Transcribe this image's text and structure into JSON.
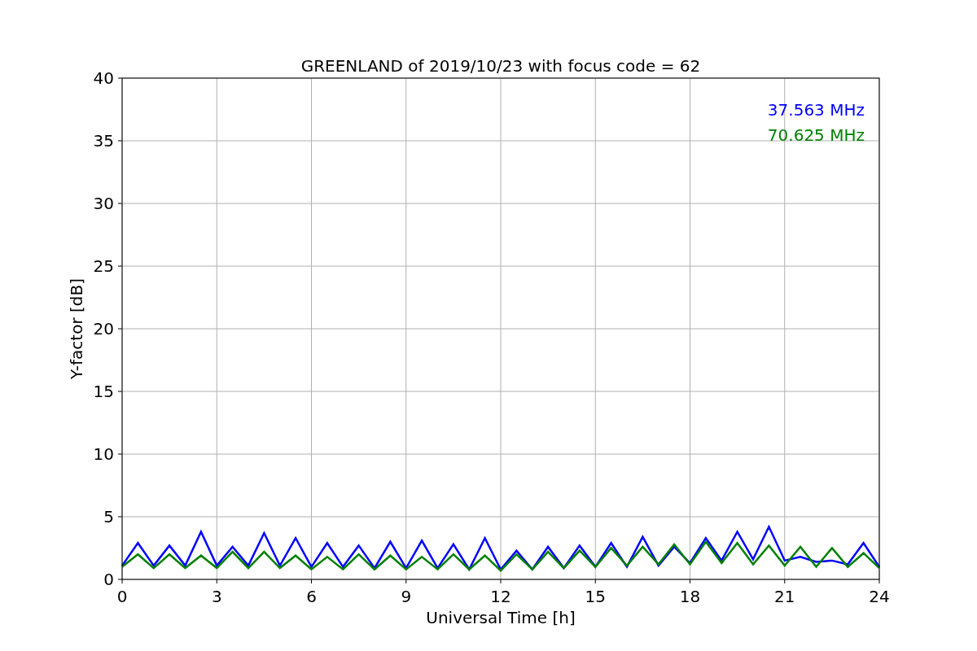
{
  "chart_data": {
    "type": "line",
    "title": "GREENLAND of 2019/10/23 with focus code = 62",
    "xlabel": "Universal Time [h]",
    "ylabel": "Y-factor [dB]",
    "x": [
      0,
      0.5,
      1,
      1.5,
      2,
      2.5,
      3,
      3.5,
      4,
      4.5,
      5,
      5.5,
      6,
      6.5,
      7,
      7.5,
      8,
      8.5,
      9,
      9.5,
      10,
      10.5,
      11,
      11.5,
      12,
      12.5,
      13,
      13.5,
      14,
      14.5,
      15,
      15.5,
      16,
      16.5,
      17,
      17.5,
      18,
      18.5,
      19,
      19.5,
      20,
      20.5,
      21,
      21.5,
      22,
      22.5,
      23,
      23.5,
      24
    ],
    "series": [
      {
        "name": "37.563 MHz",
        "color": "#0000ff",
        "values": [
          1.1,
          2.9,
          1.1,
          2.7,
          1.1,
          3.8,
          1.1,
          2.6,
          1.1,
          3.7,
          1.1,
          3.3,
          1.0,
          2.9,
          1.0,
          2.7,
          0.9,
          3.0,
          0.9,
          3.1,
          0.9,
          2.8,
          0.8,
          3.3,
          0.8,
          2.3,
          0.8,
          2.6,
          0.9,
          2.7,
          1.0,
          2.9,
          1.0,
          3.4,
          1.1,
          2.6,
          1.3,
          3.3,
          1.5,
          3.8,
          1.6,
          4.2,
          1.5,
          1.8,
          1.4,
          1.5,
          1.2,
          2.9,
          1.0
        ]
      },
      {
        "name": "70.625 MHz",
        "color": "#008000",
        "values": [
          1.0,
          2.0,
          0.9,
          2.0,
          0.9,
          1.9,
          0.9,
          2.2,
          0.9,
          2.2,
          0.9,
          1.9,
          0.8,
          1.8,
          0.8,
          2.0,
          0.8,
          1.9,
          0.8,
          1.8,
          0.8,
          2.0,
          0.8,
          1.9,
          0.7,
          2.0,
          0.8,
          2.2,
          0.9,
          2.3,
          1.0,
          2.5,
          1.1,
          2.6,
          1.2,
          2.8,
          1.2,
          3.0,
          1.3,
          2.9,
          1.2,
          2.7,
          1.1,
          2.6,
          1.0,
          2.5,
          1.0,
          2.1,
          0.9
        ]
      }
    ],
    "grid": true,
    "xlim": [
      0,
      24
    ],
    "ylim": [
      0,
      40
    ],
    "xticks": [
      0,
      3,
      6,
      9,
      12,
      15,
      18,
      21,
      24
    ],
    "yticks": [
      0,
      5,
      10,
      15,
      20,
      25,
      30,
      35,
      40
    ]
  }
}
